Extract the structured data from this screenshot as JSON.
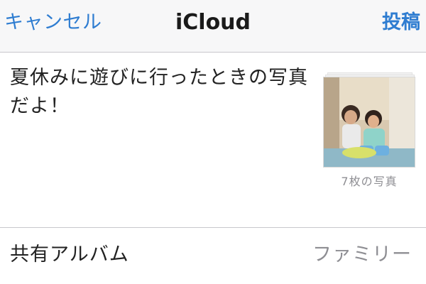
{
  "navbar": {
    "cancel_label": "キャンセル",
    "title": "iCloud",
    "post_label": "投稿"
  },
  "compose": {
    "message": "夏休みに遊びに行ったときの写真だよ！",
    "photo_count_label": "7枚の写真"
  },
  "album": {
    "label": "共有アルバム",
    "value": "ファミリー"
  },
  "colors": {
    "accent": "#2f7dd1",
    "text": "#222222",
    "secondary_text": "#8e8e93",
    "navbar_bg": "#f7f7f8",
    "separator": "#c8c7cc"
  }
}
